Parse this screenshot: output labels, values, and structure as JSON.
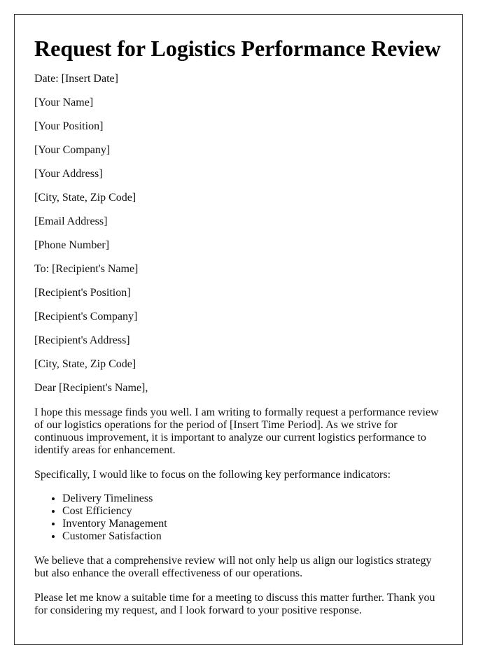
{
  "document": {
    "title": "Request for Logistics Performance Review",
    "date_line": "Date: [Insert Date]",
    "sender": [
      "[Your Name]",
      "[Your Position]",
      "[Your Company]",
      "[Your Address]",
      "[City, State, Zip Code]",
      "[Email Address]",
      "[Phone Number]"
    ],
    "recipient": [
      "To: [Recipient's Name]",
      "[Recipient's Position]",
      "[Recipient's Company]",
      "[Recipient's Address]",
      "[City, State, Zip Code]"
    ],
    "salutation": "Dear [Recipient's Name],",
    "paragraphs": [
      "I hope this message finds you well. I am writing to formally request a performance review of our logistics operations for the period of [Insert Time Period]. As we strive for continuous improvement, it is important to analyze our current logistics performance to identify areas for enhancement.",
      "Specifically, I would like to focus on the following key performance indicators:"
    ],
    "kpis": [
      "Delivery Timeliness",
      "Cost Efficiency",
      "Inventory Management",
      "Customer Satisfaction"
    ],
    "closing_paragraphs": [
      "We believe that a comprehensive review will not only help us align our logistics strategy but also enhance the overall effectiveness of our operations.",
      "Please let me know a suitable time for a meeting to discuss this matter further. Thank you for considering my request, and I look forward to your positive response."
    ]
  }
}
